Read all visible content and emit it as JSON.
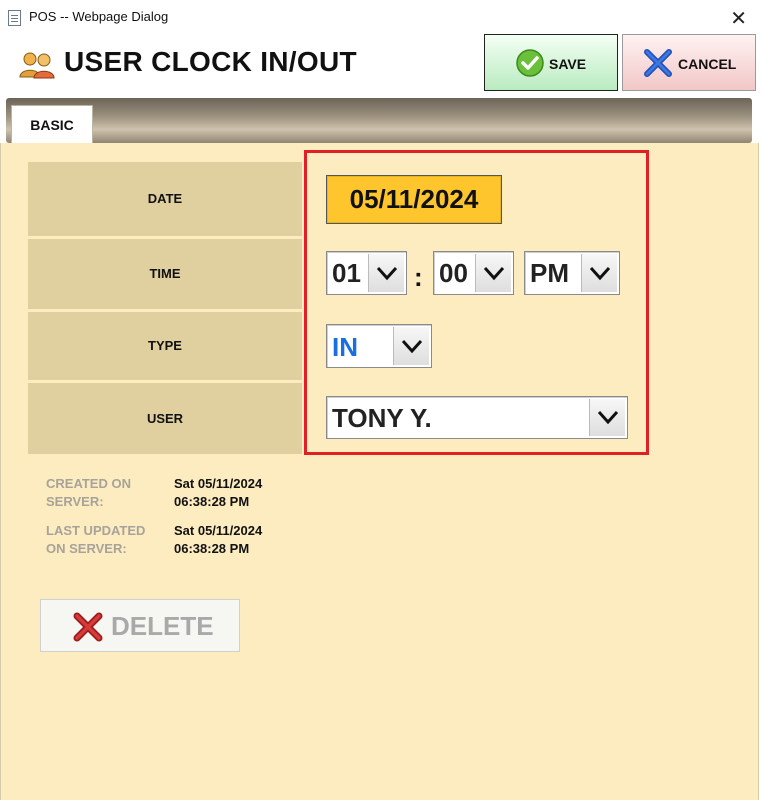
{
  "window": {
    "title": "POS -- Webpage Dialog",
    "close_glyph": "✕"
  },
  "header": {
    "title": "USER CLOCK IN/OUT",
    "icon": "users-icon"
  },
  "toolbar": {
    "save_label": "SAVE",
    "cancel_label": "CANCEL"
  },
  "tabs": [
    {
      "label": "BASIC",
      "active": true
    }
  ],
  "form": {
    "date_label": "DATE",
    "date_value": "05/11/2024",
    "time_label": "TIME",
    "hour": "01",
    "minute": "00",
    "ampm": "PM",
    "time_separator": ":",
    "type_label": "TYPE",
    "type_value": "IN",
    "user_label": "USER",
    "user_value": "TONY Y."
  },
  "meta": {
    "created_label_line1": "CREATED ON",
    "created_label_line2": "SERVER:",
    "created_date": "Sat 05/11/2024",
    "created_time": "06:38:28 PM",
    "updated_label_line1": "LAST UPDATED",
    "updated_label_line2": "ON SERVER:",
    "updated_date": "Sat 05/11/2024",
    "updated_time": "06:38:28 PM"
  },
  "actions": {
    "delete_label": "DELETE"
  },
  "colors": {
    "panel_bg": "#fdecc0",
    "label_bg": "#e0cf9f",
    "date_bg": "#ffc52c",
    "highlight_frame": "#e02025",
    "type_value_color": "#1a6fe0"
  }
}
